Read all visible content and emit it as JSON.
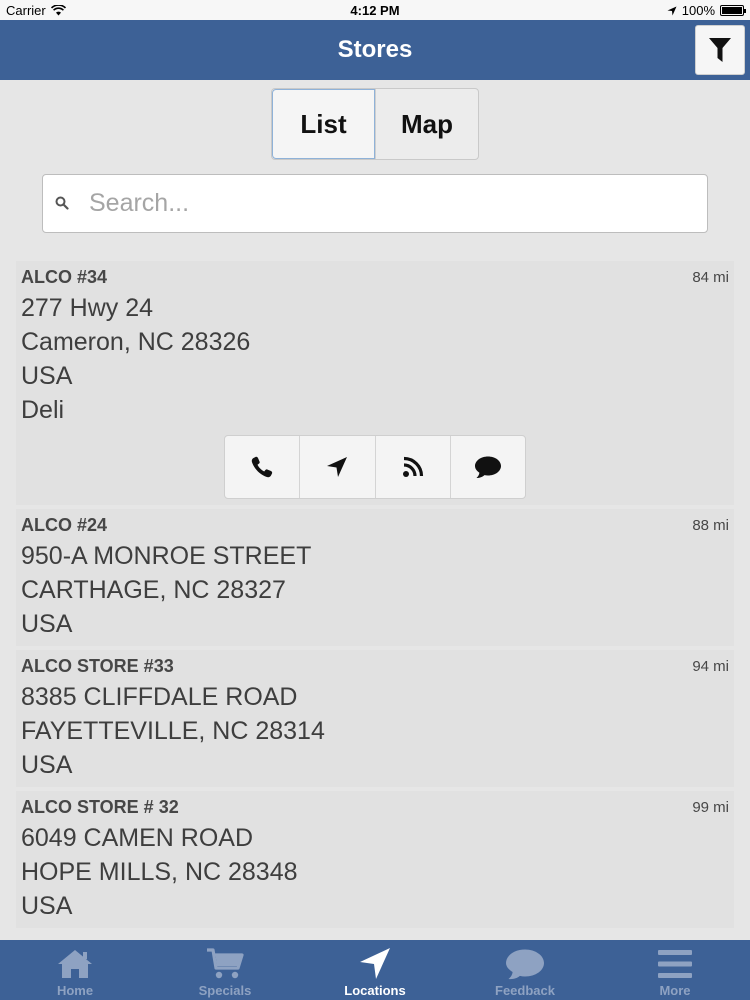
{
  "status_bar": {
    "carrier": "Carrier",
    "time": "4:12 PM",
    "battery": "100%",
    "battery_level": 1.0
  },
  "header": {
    "title": "Stores",
    "filter_icon": "filter-icon"
  },
  "view_toggle": {
    "options": [
      {
        "label": "List",
        "selected": true
      },
      {
        "label": "Map",
        "selected": false
      }
    ]
  },
  "search": {
    "placeholder": "Search...",
    "value": ""
  },
  "stores": [
    {
      "name": "ALCO #34",
      "distance": "84 mi",
      "lines": [
        "277 Hwy 24",
        "Cameron, NC 28326",
        "USA",
        "Deli"
      ],
      "expanded": true,
      "actions": [
        "phone-icon",
        "navigate-icon",
        "rss-icon",
        "chat-icon"
      ]
    },
    {
      "name": "ALCO #24",
      "distance": "88 mi",
      "lines": [
        "950-A MONROE STREET",
        "CARTHAGE, NC 28327",
        "USA"
      ]
    },
    {
      "name": "ALCO STORE #33",
      "distance": "94 mi",
      "lines": [
        "8385 CLIFFDALE ROAD",
        "FAYETTEVILLE, NC 28314",
        "USA"
      ]
    },
    {
      "name": "ALCO STORE # 32",
      "distance": "99 mi",
      "lines": [
        "6049 CAMEN ROAD",
        "HOPE MILLS, NC 28348",
        "USA"
      ]
    }
  ],
  "tabbar": {
    "tabs": [
      {
        "label": "Home",
        "icon": "home-icon"
      },
      {
        "label": "Specials",
        "icon": "cart-icon"
      },
      {
        "label": "Locations",
        "icon": "navigate-icon",
        "active": true
      },
      {
        "label": "Feedback",
        "icon": "chat-icon"
      },
      {
        "label": "More",
        "icon": "menu-icon"
      }
    ]
  },
  "colors": {
    "brand": "#3d6196",
    "tab_inactive": "#8ea2c2",
    "tab_active": "#ffffff"
  }
}
